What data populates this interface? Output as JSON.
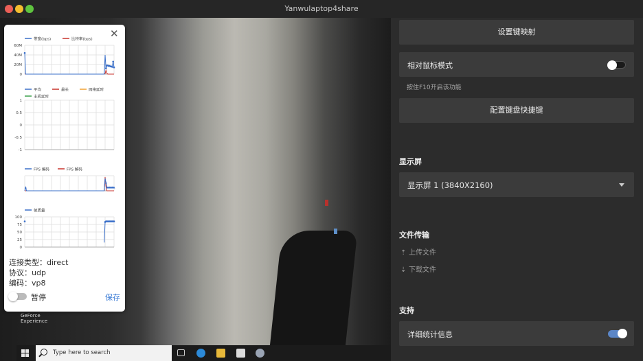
{
  "window": {
    "title": "Yanwulaptop4share"
  },
  "desktop": {
    "icon_label": "GeForce\nExperience",
    "search_placeholder": "Type here to search"
  },
  "stats": {
    "bandwidth": {
      "legend": [
        "带宽(bps)",
        "比特率(bps)"
      ],
      "y_ticks": [
        "60M",
        "40M",
        "20M",
        "0"
      ],
      "colors": [
        "#3a6fc9",
        "#c8322b"
      ],
      "series_points": [
        [
          0,
          44
        ],
        [
          1,
          0
        ],
        [
          2,
          0
        ],
        [
          3,
          0
        ],
        [
          4,
          0
        ],
        [
          5,
          0
        ],
        [
          6,
          0
        ],
        [
          7,
          0
        ],
        [
          8,
          0
        ],
        [
          9,
          0
        ],
        [
          10,
          0
        ],
        [
          11,
          0
        ],
        [
          12,
          0
        ],
        [
          13,
          0
        ],
        [
          14,
          0
        ],
        [
          15,
          0
        ],
        [
          16,
          0
        ],
        [
          17,
          0
        ],
        [
          18,
          0
        ],
        [
          19,
          0
        ],
        [
          20,
          0
        ],
        [
          21,
          0
        ],
        [
          22,
          0
        ],
        [
          23,
          0
        ],
        [
          24,
          0
        ],
        [
          25,
          0
        ],
        [
          26,
          0
        ],
        [
          27,
          0
        ],
        [
          28,
          0
        ],
        [
          29,
          0
        ],
        [
          30,
          0
        ],
        [
          31,
          0
        ],
        [
          32,
          0
        ],
        [
          33,
          0
        ],
        [
          34,
          0
        ],
        [
          35,
          0
        ],
        [
          36,
          0
        ],
        [
          37,
          0
        ],
        [
          38,
          0
        ],
        [
          39,
          0
        ],
        [
          40,
          0
        ],
        [
          41,
          0
        ],
        [
          42,
          0
        ],
        [
          43,
          0
        ],
        [
          44,
          0
        ],
        [
          45,
          0
        ],
        [
          46,
          0
        ],
        [
          47,
          0
        ],
        [
          48,
          0
        ],
        [
          49,
          0
        ],
        [
          50,
          0
        ],
        [
          51,
          0
        ],
        [
          52,
          0
        ],
        [
          53,
          0
        ],
        [
          54,
          0
        ],
        [
          55,
          0
        ],
        [
          56,
          0
        ],
        [
          57,
          0
        ],
        [
          58,
          0
        ],
        [
          59,
          0
        ],
        [
          60,
          0
        ],
        [
          61,
          0
        ],
        [
          62,
          0
        ],
        [
          63,
          0
        ],
        [
          64,
          0
        ],
        [
          65,
          0
        ],
        [
          66,
          0
        ],
        [
          67,
          0
        ],
        [
          68,
          0
        ],
        [
          69,
          0
        ],
        [
          70,
          0
        ],
        [
          71,
          0
        ],
        [
          72,
          0
        ],
        [
          73,
          0
        ],
        [
          74,
          0
        ],
        [
          75,
          0
        ],
        [
          76,
          0
        ],
        [
          77,
          0
        ],
        [
          78,
          0
        ],
        [
          79,
          0
        ],
        [
          80,
          0
        ],
        [
          81,
          0
        ],
        [
          82,
          0
        ],
        [
          83,
          0
        ],
        [
          84,
          0
        ],
        [
          85,
          0
        ],
        [
          86,
          0
        ],
        [
          87,
          0
        ],
        [
          88,
          0
        ],
        [
          89,
          0
        ],
        [
          90,
          40
        ],
        [
          91,
          12
        ],
        [
          92,
          18
        ],
        [
          93,
          18
        ],
        [
          94,
          17
        ],
        [
          95,
          17
        ],
        [
          96,
          16
        ],
        [
          97,
          16
        ],
        [
          98,
          15
        ],
        [
          99,
          26
        ],
        [
          100,
          14
        ]
      ],
      "series2_points": [
        [
          0,
          0
        ],
        [
          89,
          0
        ],
        [
          90,
          1
        ],
        [
          91,
          8
        ],
        [
          92,
          2
        ],
        [
          93,
          0
        ],
        [
          100,
          0
        ]
      ],
      "y_max": 60
    },
    "latency": {
      "legend": [
        "平均",
        "最长",
        "网络延时",
        "主机延时"
      ],
      "y_ticks": [
        "1",
        "0.5",
        "0",
        "-0.5",
        "-1"
      ],
      "colors": [
        "#3a6fc9",
        "#c8322b",
        "#f0a030",
        "#3aa04a"
      ]
    },
    "fps": {
      "legend": [
        "FPS 编码",
        "FPS 解码"
      ],
      "colors": [
        "#3a6fc9",
        "#c8322b"
      ],
      "enc": [
        0,
        5,
        0,
        0,
        0,
        0,
        0,
        0,
        0,
        0,
        0,
        0,
        0,
        0,
        0,
        0,
        0,
        0,
        0,
        0,
        0,
        0,
        0,
        0,
        0,
        0,
        0,
        0,
        0,
        0,
        0,
        0,
        0,
        0,
        0,
        0,
        0,
        0,
        0,
        0,
        0,
        0,
        0,
        0,
        0,
        0,
        0,
        0,
        0,
        0,
        0,
        0,
        0,
        0,
        0,
        0,
        0,
        0,
        0,
        0,
        0,
        0,
        0,
        0,
        0,
        0,
        0,
        0,
        0,
        0,
        0,
        0,
        0,
        0,
        0,
        0,
        0,
        0,
        0,
        0,
        0,
        0,
        0,
        0,
        0,
        0,
        0,
        0,
        0,
        0,
        18,
        12,
        5,
        5,
        5,
        5,
        5,
        5,
        5,
        5,
        5
      ],
      "dec": [
        0,
        0,
        0,
        0,
        0,
        0,
        0,
        0,
        0,
        0,
        0,
        0,
        0,
        0,
        0,
        0,
        0,
        0,
        0,
        0,
        0,
        0,
        0,
        0,
        0,
        0,
        0,
        0,
        0,
        0,
        0,
        0,
        0,
        0,
        0,
        0,
        0,
        0,
        0,
        0,
        0,
        0,
        0,
        0,
        0,
        0,
        0,
        0,
        0,
        0,
        0,
        0,
        0,
        0,
        0,
        0,
        0,
        0,
        0,
        0,
        0,
        0,
        0,
        0,
        0,
        0,
        0,
        0,
        0,
        0,
        0,
        0,
        0,
        0,
        0,
        0,
        0,
        0,
        0,
        0,
        0,
        0,
        0,
        0,
        0,
        0,
        0,
        0,
        0,
        0,
        20,
        6,
        0,
        0,
        0,
        0,
        0,
        0,
        0,
        0,
        0
      ],
      "y_max": 22
    },
    "quality": {
      "legend": [
        "帧质量"
      ],
      "y_ticks": [
        "100",
        "75",
        "50",
        "25",
        "0"
      ],
      "colors": [
        "#3a6fc9"
      ],
      "points": [
        [
          0,
          85
        ],
        [
          89,
          15
        ],
        [
          90,
          83
        ],
        [
          91,
          85
        ],
        [
          92,
          85
        ],
        [
          93,
          85
        ],
        [
          94,
          85
        ],
        [
          95,
          85
        ],
        [
          96,
          85
        ],
        [
          97,
          85
        ],
        [
          98,
          85
        ],
        [
          99,
          85
        ],
        [
          100,
          85
        ]
      ],
      "y_max": 100
    },
    "connection_type": "连接类型：direct",
    "protocol": "协议：udp",
    "codec": "编码：vp8",
    "pause_label": "暂停",
    "save_label": "保存"
  },
  "panel": {
    "key_mapping_button": "设置键映射",
    "relative_mouse_label": "相对鼠标模式",
    "relative_mouse_hint": "按住F10开启该功能",
    "keyboard_shortcuts_button": "配置键盘快捷键",
    "display_section": "显示屏",
    "display_selected": "显示屏 1 (3840X2160)",
    "file_section": "文件传输",
    "upload_label": "上传文件",
    "download_label": "下载文件",
    "support_section": "支持",
    "detailed_stats_label": "详细统计信息",
    "relative_mouse_on": false,
    "detailed_stats_on": true
  }
}
